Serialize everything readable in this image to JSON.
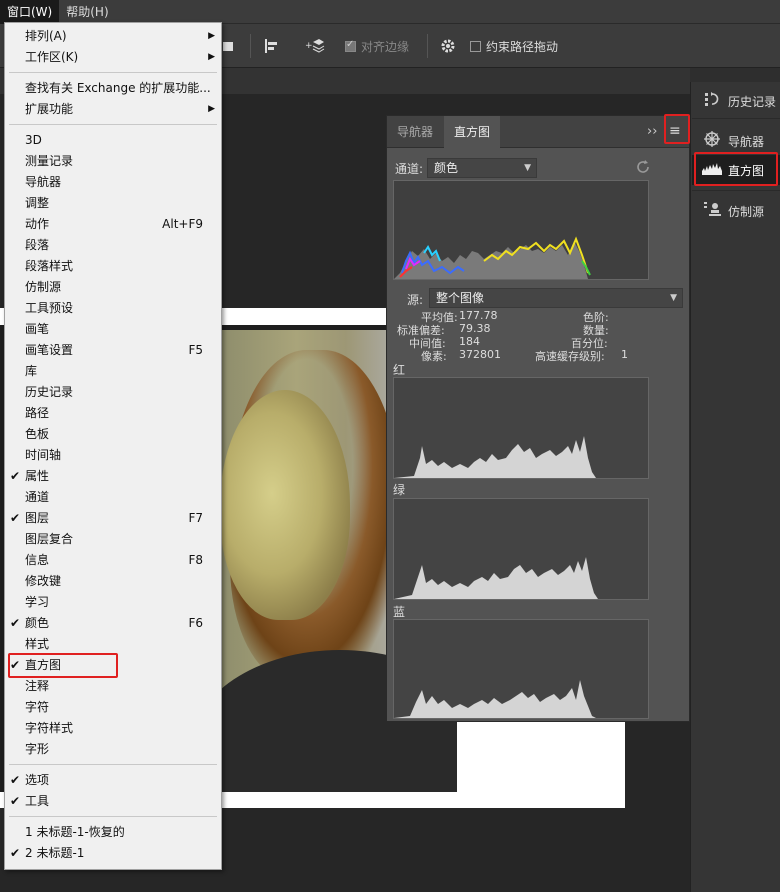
{
  "menubar": {
    "items": [
      "窗口(W)",
      "帮助(H)"
    ]
  },
  "options_bar": {
    "align_edges": "对齐边缘",
    "constrain_path": "约束路径拖动"
  },
  "window_menu": {
    "items": [
      {
        "label": "排列(A)",
        "submenu": true
      },
      {
        "label": "工作区(K)",
        "submenu": true
      },
      {
        "sep": true
      },
      {
        "label": "查找有关 Exchange 的扩展功能..."
      },
      {
        "label": "扩展功能",
        "submenu": true
      },
      {
        "sep": true
      },
      {
        "label": "3D"
      },
      {
        "label": "测量记录"
      },
      {
        "label": "导航器"
      },
      {
        "label": "调整"
      },
      {
        "label": "动作",
        "shortcut": "Alt+F9"
      },
      {
        "label": "段落"
      },
      {
        "label": "段落样式"
      },
      {
        "label": "仿制源"
      },
      {
        "label": "工具预设"
      },
      {
        "label": "画笔"
      },
      {
        "label": "画笔设置",
        "shortcut": "F5"
      },
      {
        "label": "库"
      },
      {
        "label": "历史记录"
      },
      {
        "label": "路径"
      },
      {
        "label": "色板"
      },
      {
        "label": "时间轴"
      },
      {
        "label": "属性",
        "checked": true
      },
      {
        "label": "通道"
      },
      {
        "label": "图层",
        "checked": true,
        "shortcut": "F7"
      },
      {
        "label": "图层复合"
      },
      {
        "label": "信息",
        "shortcut": "F8"
      },
      {
        "label": "修改键"
      },
      {
        "label": "学习"
      },
      {
        "label": "颜色",
        "checked": true,
        "shortcut": "F6"
      },
      {
        "label": "样式"
      },
      {
        "label": "直方图",
        "checked": true,
        "highlighted": true
      },
      {
        "label": "注释"
      },
      {
        "label": "字符"
      },
      {
        "label": "字符样式"
      },
      {
        "label": "字形"
      },
      {
        "sep": true
      },
      {
        "label": "选项",
        "checked": true
      },
      {
        "label": "工具",
        "checked": true
      },
      {
        "sep": true
      },
      {
        "label": "1 未标题-1-恢复的"
      },
      {
        "label": "2 未标题-1",
        "checked": true
      }
    ]
  },
  "dock": {
    "items": [
      {
        "label": "历史记录",
        "icon": "history-icon"
      },
      {
        "label": "导航器",
        "icon": "navigator-icon"
      },
      {
        "label": "直方图",
        "icon": "histogram-icon",
        "selected": true
      },
      {
        "label": "仿制源",
        "icon": "clone-source-icon"
      }
    ]
  },
  "histogram_panel": {
    "tabs": [
      "导航器",
      "直方图"
    ],
    "expand_glyph": "››",
    "menu_glyph": "≡",
    "channel_label": "通道:",
    "channel_value": "颜色",
    "source_label": "源:",
    "source_value": "整个图像",
    "stats": {
      "mean_label": "平均值:",
      "mean": "177.78",
      "std_label": "标准偏差:",
      "std": "79.38",
      "median_label": "中间值:",
      "median": "184",
      "pixels_label": "像素:",
      "pixels": "372801",
      "level_label": "色阶:",
      "count_label": "数量:",
      "percentile_label": "百分位:",
      "cache_label": "高速缓存级别:",
      "cache": "1"
    },
    "channels": [
      "红",
      "绿",
      "蓝"
    ]
  },
  "colors": {
    "highlight_red": "#e02020",
    "panel_bg": "#535353",
    "menu_bg": "#f0f0f0"
  }
}
